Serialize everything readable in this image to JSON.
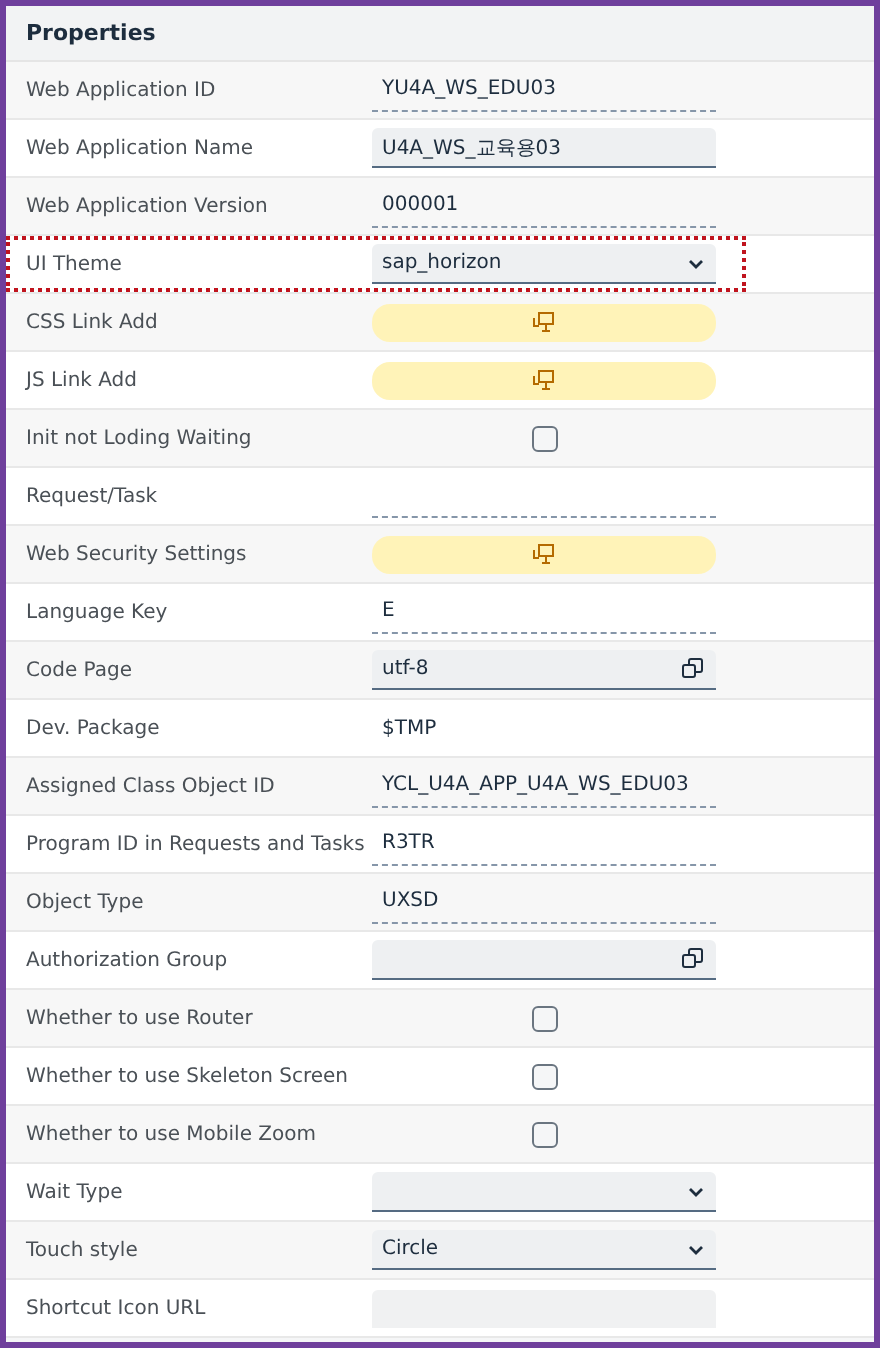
{
  "panel": {
    "title": "Properties"
  },
  "rows": [
    {
      "label": "Web Application ID",
      "kind": "display",
      "value": "YU4A_WS_EDU03",
      "highlighted": false
    },
    {
      "label": "Web Application Name",
      "kind": "input",
      "value": "U4A_WS_교육용03",
      "highlighted": false
    },
    {
      "label": "Web Application Version",
      "kind": "display",
      "value": "000001",
      "highlighted": false
    },
    {
      "label": "UI Theme",
      "kind": "select",
      "value": "sap_horizon",
      "highlighted": true
    },
    {
      "label": "CSS Link Add",
      "kind": "button",
      "highlighted": false
    },
    {
      "label": "JS Link Add",
      "kind": "button",
      "highlighted": false
    },
    {
      "label": "Init not Loding Waiting",
      "kind": "checkbox",
      "checked": false,
      "highlighted": false
    },
    {
      "label": "Request/Task",
      "kind": "display",
      "highlighted": false
    },
    {
      "label": "Web Security Settings",
      "kind": "button",
      "highlighted": false
    },
    {
      "label": "Language Key",
      "kind": "display",
      "value": "E",
      "highlighted": false
    },
    {
      "label": "Code Page",
      "kind": "value_help",
      "value": "utf-8",
      "highlighted": false
    },
    {
      "label": "Dev. Package",
      "kind": "text",
      "value": "$TMP",
      "highlighted": false
    },
    {
      "label": "Assigned Class Object ID",
      "kind": "display",
      "value": "YCL_U4A_APP_U4A_WS_EDU03",
      "highlighted": false
    },
    {
      "label": "Program ID in Requests and Tasks",
      "kind": "display",
      "value": "R3TR",
      "highlighted": false
    },
    {
      "label": "Object Type",
      "kind": "display",
      "value": "UXSD",
      "highlighted": false
    },
    {
      "label": "Authorization Group",
      "kind": "value_help",
      "highlighted": false
    },
    {
      "label": "Whether to use Router",
      "kind": "checkbox",
      "checked": false,
      "highlighted": false
    },
    {
      "label": "Whether to use Skeleton Screen",
      "kind": "checkbox",
      "checked": false,
      "highlighted": false
    },
    {
      "label": "Whether to use Mobile Zoom",
      "kind": "checkbox",
      "checked": false,
      "highlighted": false
    },
    {
      "label": "Wait Type",
      "kind": "select",
      "highlighted": false
    },
    {
      "label": "Touch style",
      "kind": "select",
      "value": "Circle",
      "highlighted": false
    },
    {
      "label": "Shortcut Icon URL",
      "kind": "disabled",
      "highlighted": false
    }
  ]
}
